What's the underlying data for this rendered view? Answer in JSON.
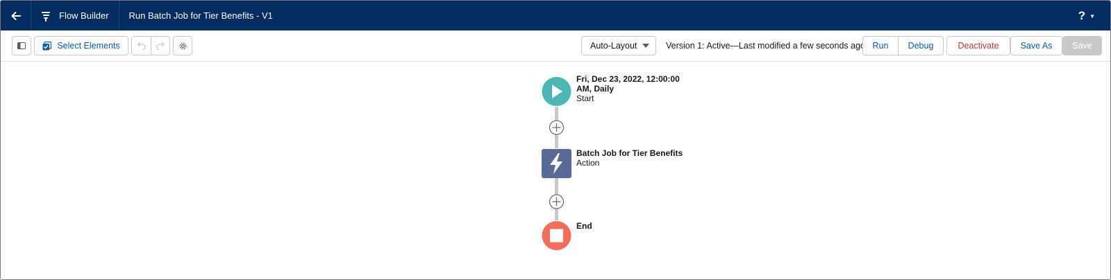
{
  "header": {
    "app_name": "Flow Builder",
    "flow_title": "Run Batch Job for Tier Benefits - V1",
    "help_label": "?"
  },
  "toolbar": {
    "select_elements_label": "Select Elements",
    "layout_select_value": "Auto-Layout",
    "version_status": "Version 1: Active—Last modified a few seconds ago",
    "run_label": "Run",
    "debug_label": "Debug",
    "deactivate_label": "Deactivate",
    "save_as_label": "Save As",
    "save_label": "Save"
  },
  "flow": {
    "start": {
      "line1": "Fri, Dec 23, 2022, 12:00:00",
      "line2": "AM, Daily",
      "type": "Start"
    },
    "action": {
      "name": "Batch Job for Tier Benefits",
      "type": "Action"
    },
    "end": {
      "name": "End"
    }
  },
  "colors": {
    "header_bg": "#032d60",
    "start_node": "#4bb8b4",
    "action_node": "#566a94",
    "end_node": "#f26e5a",
    "connector": "#c9c9c9",
    "deactivate_text": "#c23934",
    "link_text": "#0b5cab"
  },
  "icons": [
    "back-arrow-icon",
    "flow-icon",
    "help-icon",
    "toggle-panel-icon",
    "select-elements-icon",
    "undo-icon",
    "redo-icon",
    "settings-gear-icon",
    "dropdown-caret-icon",
    "play-icon",
    "lightning-icon",
    "stop-icon",
    "add-plus-icon"
  ]
}
